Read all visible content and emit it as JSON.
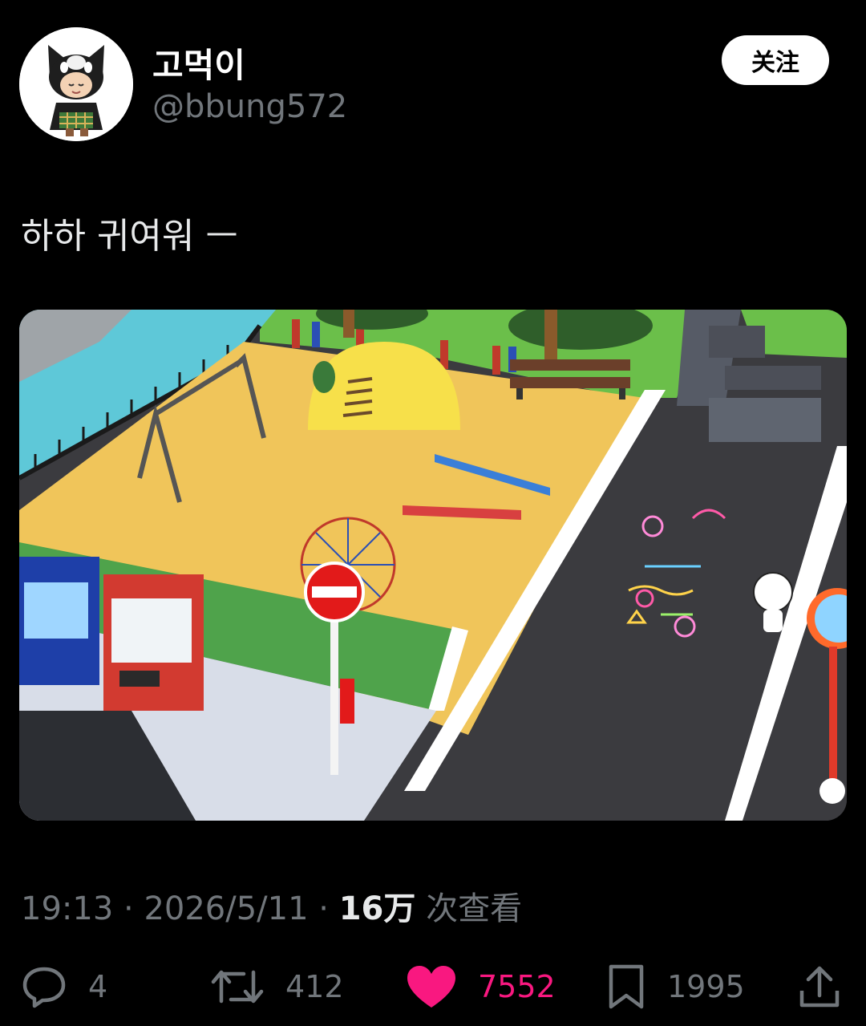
{
  "author": {
    "display_name": "고먹이",
    "handle": "@bbung572"
  },
  "follow_button": {
    "label": "关注"
  },
  "tweet": {
    "text": "하하 귀여워 ㅡ"
  },
  "meta": {
    "time": "19:13",
    "separator1": " · ",
    "date": "2026/5/11",
    "separator2": " · ",
    "views": "16万",
    "views_label": " 次查看"
  },
  "actions": {
    "reply_count": "4",
    "retweet_count": "412",
    "like_count": "7552",
    "bookmark_count": "1995"
  },
  "colors": {
    "background": "#000000",
    "secondary_text": "#71767b",
    "like": "#f91880"
  },
  "icons": [
    "reply-icon",
    "retweet-icon",
    "heart-icon",
    "bookmark-icon",
    "share-icon"
  ]
}
